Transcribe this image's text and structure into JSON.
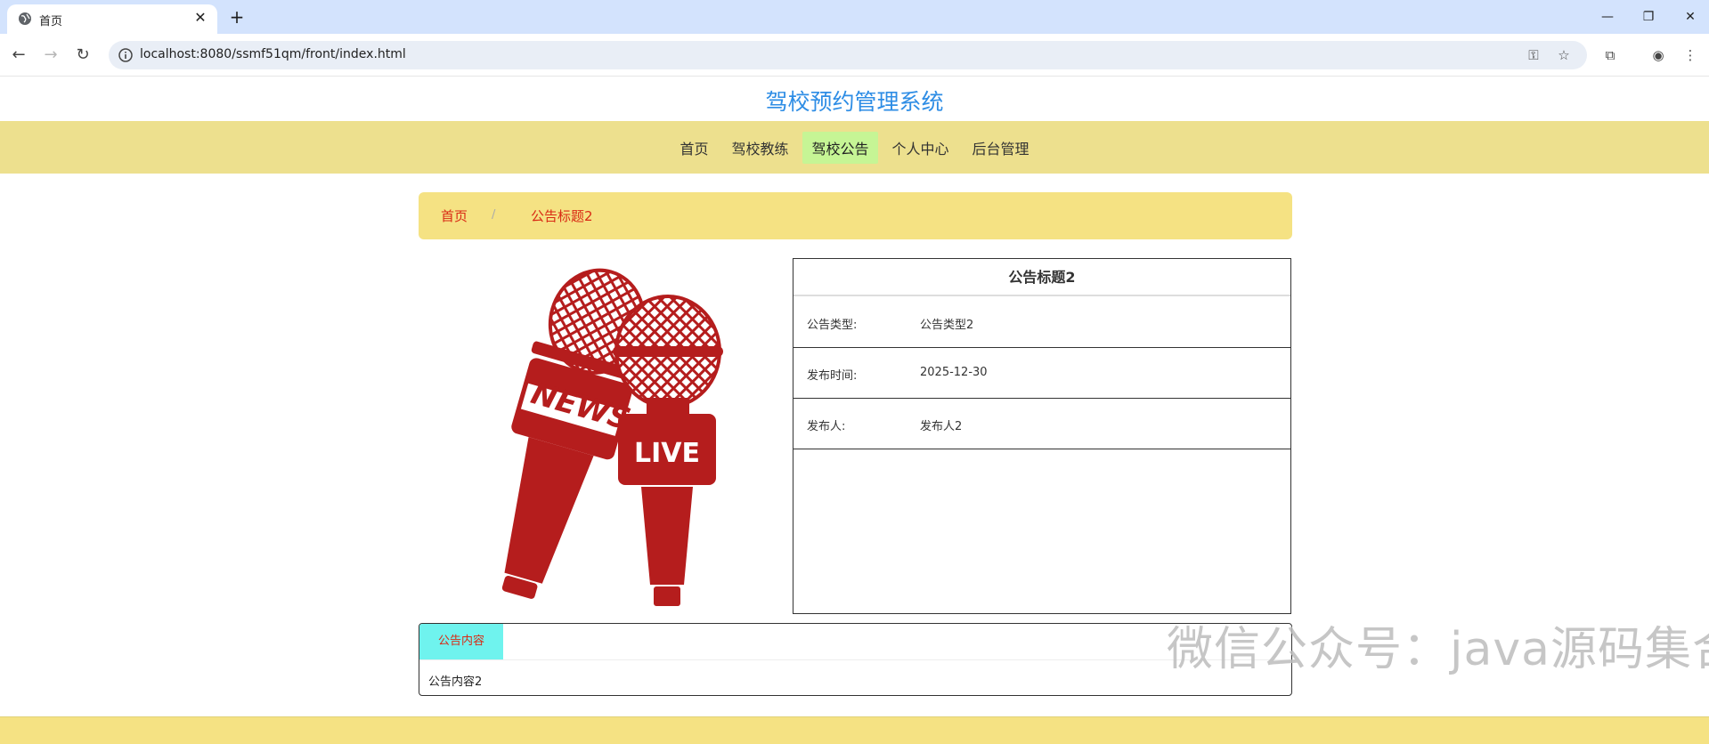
{
  "browser": {
    "tab_title": "首页",
    "url": "localhost:8080/ssmf51qm/front/index.html"
  },
  "site": {
    "title": "驾校预约管理系统"
  },
  "nav": {
    "items": [
      "首页",
      "驾校教练",
      "驾校公告",
      "个人中心",
      "后台管理"
    ],
    "active_index": 2
  },
  "breadcrumb": {
    "home": "首页",
    "separator": "/",
    "current": "公告标题2"
  },
  "image": {
    "mic_news_text": "NEWS",
    "mic_live_text": "LIVE"
  },
  "detail": {
    "title": "公告标题2",
    "rows": [
      {
        "label": "公告类型:",
        "value": "公告类型2"
      },
      {
        "label": "发布时间:",
        "value": "2025-12-30"
      },
      {
        "label": "发布人:",
        "value": "发布人2"
      }
    ]
  },
  "content": {
    "tab_label": "公告内容",
    "text": "公告内容2"
  },
  "watermark": "微信公众号：java源码集合",
  "colors": {
    "title_blue": "#2e8de5",
    "nav_bg": "#ede08e",
    "nav_active": "#c6f595",
    "breadcrumb_bg": "#f5e283",
    "accent_red": "#d92a14",
    "tab_cyan": "#6ff3ee",
    "mic_red": "#b51d1d"
  }
}
